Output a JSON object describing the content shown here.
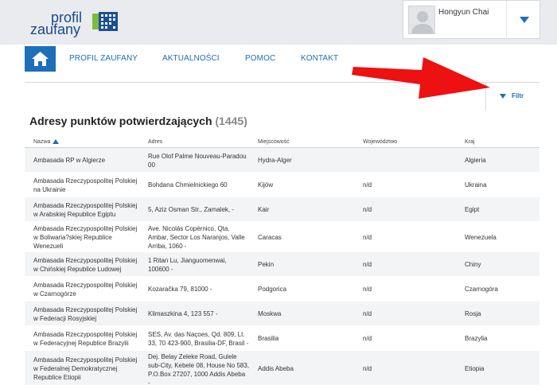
{
  "logo": {
    "line1": "profil",
    "line2": "zaufany"
  },
  "user": {
    "name": "Hongyun Chai"
  },
  "colorbar": [
    "#1d6fb8",
    "#f2a52b",
    "#43a047",
    "#e53935"
  ],
  "nav": {
    "items": [
      {
        "label": "PROFIL ZAUFANY"
      },
      {
        "label": "AKTUALNOŚCI"
      },
      {
        "label": "POMOC"
      },
      {
        "label": "KONTAKT"
      }
    ]
  },
  "filter": {
    "label": "Filtr"
  },
  "heading": {
    "title": "Adresy punktów potwierdzających",
    "count": "(1445)"
  },
  "table": {
    "headers": [
      "Nazwa",
      "Adres",
      "Miejscowość",
      "Województwo",
      "Kraj"
    ],
    "rows": [
      {
        "name": [
          "Ambasada RP w Algierze"
        ],
        "address": [
          "Rue Olof Palme Nouveau-Paradou",
          "00"
        ],
        "city": "Hydra-Alger",
        "voiv": "",
        "country": "Algieria"
      },
      {
        "name": [
          "Ambasada Rzeczypospolitej Polskiej",
          "na Ukrainie"
        ],
        "address": [
          "Bohdana Chmielnickiego 60"
        ],
        "city": "Kijów",
        "voiv": "n/d",
        "country": "Ukraina"
      },
      {
        "name": [
          "Ambasada Rzeczypospolitej Polskiej",
          "w Arabskiej Republice Egiptu"
        ],
        "address": [
          "5, Aziz Osman Str., Zamalek, -"
        ],
        "city": "Kair",
        "voiv": "n/d",
        "country": "Egipt"
      },
      {
        "name": [
          "Ambasada Rzeczypospolitej Polskiej",
          "w Boliwaria?skiej Republice",
          "Wenezueli"
        ],
        "address": [
          "Ave. Nicolás Copérnico, Qta.",
          "Ambar, Sector Los Naranjos, Valle",
          "Arriba, 1060 -"
        ],
        "city": "Caracas",
        "voiv": "n/d",
        "country": "Wenezuela"
      },
      {
        "name": [
          "Ambasada Rzeczypospolitej Polskiej",
          "w Chińskiej Republice Ludowej"
        ],
        "address": [
          "1 Ritan Lu, Jianguomenwai,",
          "100600 -"
        ],
        "city": "Pekin",
        "voiv": "n/d",
        "country": "Chiny"
      },
      {
        "name": [
          "Ambasada Rzeczypospolitej Polskiej",
          "w Czarnogórze"
        ],
        "address": [
          "Kozaračka 79, 81000 -"
        ],
        "city": "Podgorica",
        "voiv": "n/d",
        "country": "Czarnogóra"
      },
      {
        "name": [
          "Ambasada Rzeczypospolitej Polskiej",
          "w Federacji Rosyjskiej"
        ],
        "address": [
          "Klimaszkina 4, 123 557 -"
        ],
        "city": "Moskwa",
        "voiv": "n/d",
        "country": "Rosja"
      },
      {
        "name": [
          "Ambasada Rzeczypospolitej Polskiej",
          "w Federacyjnej Republice Brazylii"
        ],
        "address": [
          "SES, Av. das Naçoes, Qd. 809, Lt.",
          "33, 70 423-900, Brasilia-DF, Brasil -"
        ],
        "city": "Brasilia",
        "voiv": "n/d",
        "country": "Brazylia"
      },
      {
        "name": [
          "Ambasada Rzeczypospolitej Polskiej",
          "w Federalnej Demokratycznej",
          "Republice Etiopii"
        ],
        "address": [
          "Dej. Belay Zeleke Road, Gulele",
          "sub-City, Kebele 08, House No 583,",
          "P.O.Box 27207, 1000 Addis Abeba",
          "-"
        ],
        "city": "Addis Abeba",
        "voiv": "n/d",
        "country": "Etiopia"
      }
    ]
  }
}
